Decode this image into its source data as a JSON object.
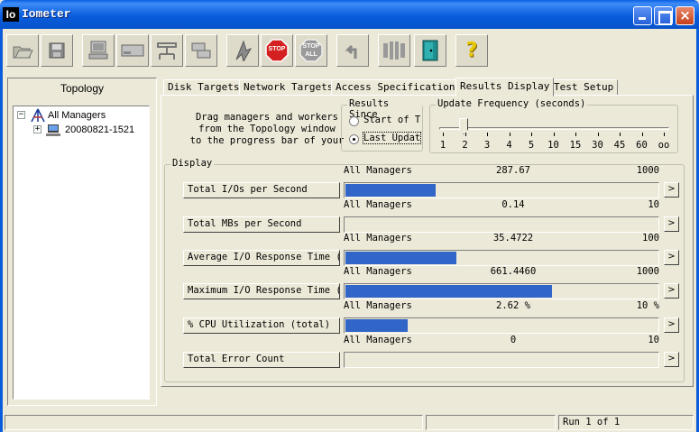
{
  "window": {
    "title": "Iometer",
    "logo_text": "Io"
  },
  "toolbar": {
    "buttons": [
      "open-icon",
      "save-icon",
      "new-manager-icon",
      "new-worker-icon",
      "network-icon",
      "copy-worker-icon",
      "start-icon",
      "stop-icon",
      "stop-all-icon",
      "reset-icon",
      "exit-icon",
      "quit-icon",
      "help-icon"
    ],
    "stop_text": "STOP",
    "stop_all_text": "STOP",
    "stop_all_sub": "ALL",
    "help_text": "?"
  },
  "topology": {
    "title": "Topology",
    "root": "All Managers",
    "manager": "20080821-1521"
  },
  "tabs": [
    "Disk Targets",
    "Network Targets",
    "Access Specifications",
    "Results Display",
    "Test Setup"
  ],
  "active_tab": "Results Display",
  "info_text": {
    "line1": "Drag managers and workers",
    "line2": "from the Topology window",
    "line3": "to the progress bar of your"
  },
  "results_since": {
    "legend": "Results Since",
    "option1": "Start of T",
    "option2": "Last Updat",
    "selected": "Last Updat"
  },
  "update_frequency": {
    "legend": "Update Frequency (seconds)",
    "ticks": [
      "1",
      "2",
      "3",
      "4",
      "5",
      "10",
      "15",
      "30",
      "45",
      "60",
      "oo"
    ],
    "selected": "2"
  },
  "display": {
    "legend": "Display",
    "metrics": [
      {
        "button": "Total I/Os per Second",
        "target": "All Managers",
        "value": "287.67",
        "max": "1000",
        "fraction": 0.288
      },
      {
        "button": "Total MBs per Second",
        "target": "All Managers",
        "value": "0.14",
        "max": "10",
        "fraction": 0.0
      },
      {
        "button": "Average I/O Response Time (m",
        "target": "All Managers",
        "value": "35.4722",
        "max": "100",
        "fraction": 0.355
      },
      {
        "button": "Maximum I/O Response Time (m",
        "target": "All Managers",
        "value": "661.4460",
        "max": "1000",
        "fraction": 0.661
      },
      {
        "button": "% CPU Utilization (total)",
        "target": "All Managers",
        "value": "2.62 %",
        "max": "10 %",
        "fraction": 0.2
      },
      {
        "button": "Total Error Count",
        "target": "All Managers",
        "value": "0",
        "max": "10",
        "fraction": 0.0
      }
    ],
    "arrow": ">"
  },
  "status_bar": {
    "run_status": "Run 1 of 1"
  },
  "colors": {
    "bar": "#3165C8",
    "titlebar": "#0A5CDC",
    "face": "#ECE9D8"
  }
}
